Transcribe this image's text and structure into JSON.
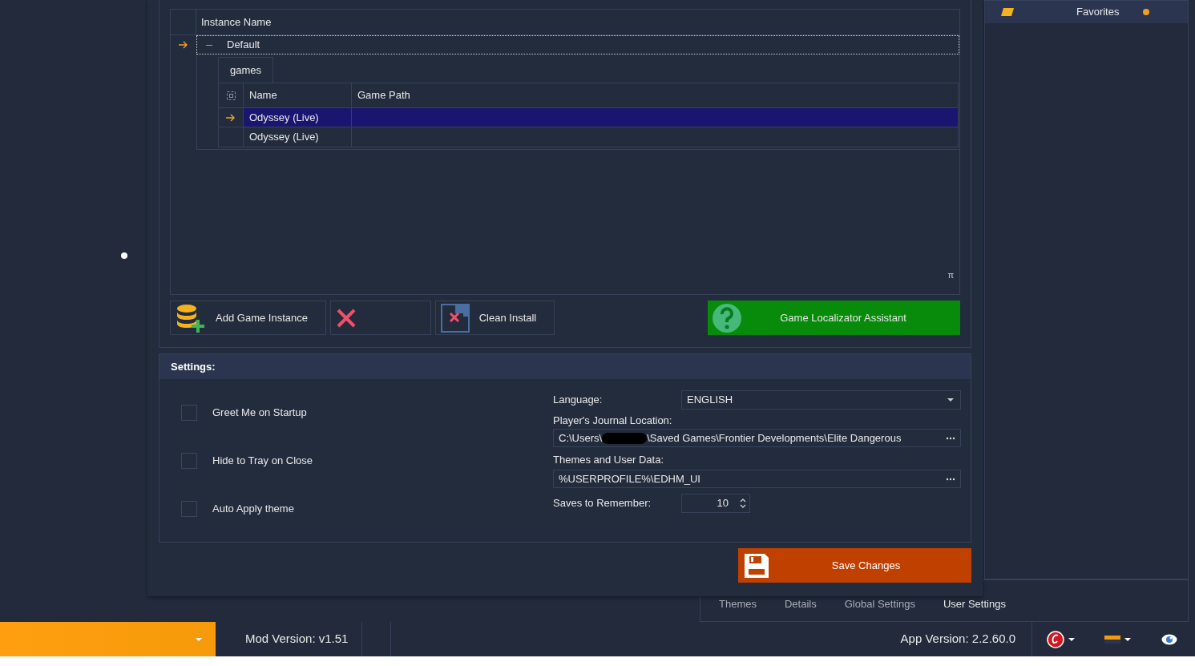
{
  "background": {
    "favorites": {
      "label": "Favorites"
    },
    "tabs": [
      {
        "label": "Themes",
        "selected": false
      },
      {
        "label": "Details",
        "selected": false
      },
      {
        "label": "Global Settings",
        "selected": false
      },
      {
        "label": "User Settings",
        "selected": true
      }
    ]
  },
  "dialog": {
    "grid": {
      "columns": [
        "Instance Name"
      ],
      "rows": [
        {
          "name": "Default",
          "current": true,
          "expanded": true,
          "detail": {
            "tabs": [
              {
                "label": "games",
                "selected": true
              }
            ],
            "columns": [
              "Name",
              "Game Path"
            ],
            "rows": [
              {
                "name": "Odyssey (Live)",
                "selected": true,
                "current": true
              },
              {
                "name": "Odyssey (Live)",
                "selected": false,
                "current": false
              }
            ]
          }
        }
      ],
      "grip_glyph": "π"
    },
    "buttons": [
      {
        "kind": "add",
        "label": "Add Game Instance"
      },
      {
        "kind": "delete"
      },
      {
        "kind": "clean",
        "label": "Clean Install"
      },
      {
        "kind": "help",
        "label": "Game Localizator Assistant"
      }
    ],
    "settings": {
      "title": "Settings:",
      "checkboxes": [
        {
          "label": "Greet Me on Startup",
          "checked": false
        },
        {
          "label": "Hide to Tray on Close",
          "checked": false
        },
        {
          "label": "Auto Apply theme",
          "checked": false
        }
      ],
      "language": {
        "label": "Language:",
        "value": "ENGLISH"
      },
      "journal": {
        "label": "Player's Journal Location:",
        "value_start": "C:\\Users\\",
        "redacted": true,
        "value_end": "\\Saved Games\\Frontier Developments\\Elite Dangerous"
      },
      "themes": {
        "label": "Themes and User Data:",
        "value": "%USERPROFILE%\\EDHM_UI"
      },
      "saves": {
        "label": "Saves to Remember:",
        "value": "10"
      }
    },
    "save_button": {
      "label": "Save Changes"
    }
  },
  "status_bar": {
    "mod_version": "Mod Version: v1.51",
    "app_version": "App Version: 2.2.60.0"
  }
}
